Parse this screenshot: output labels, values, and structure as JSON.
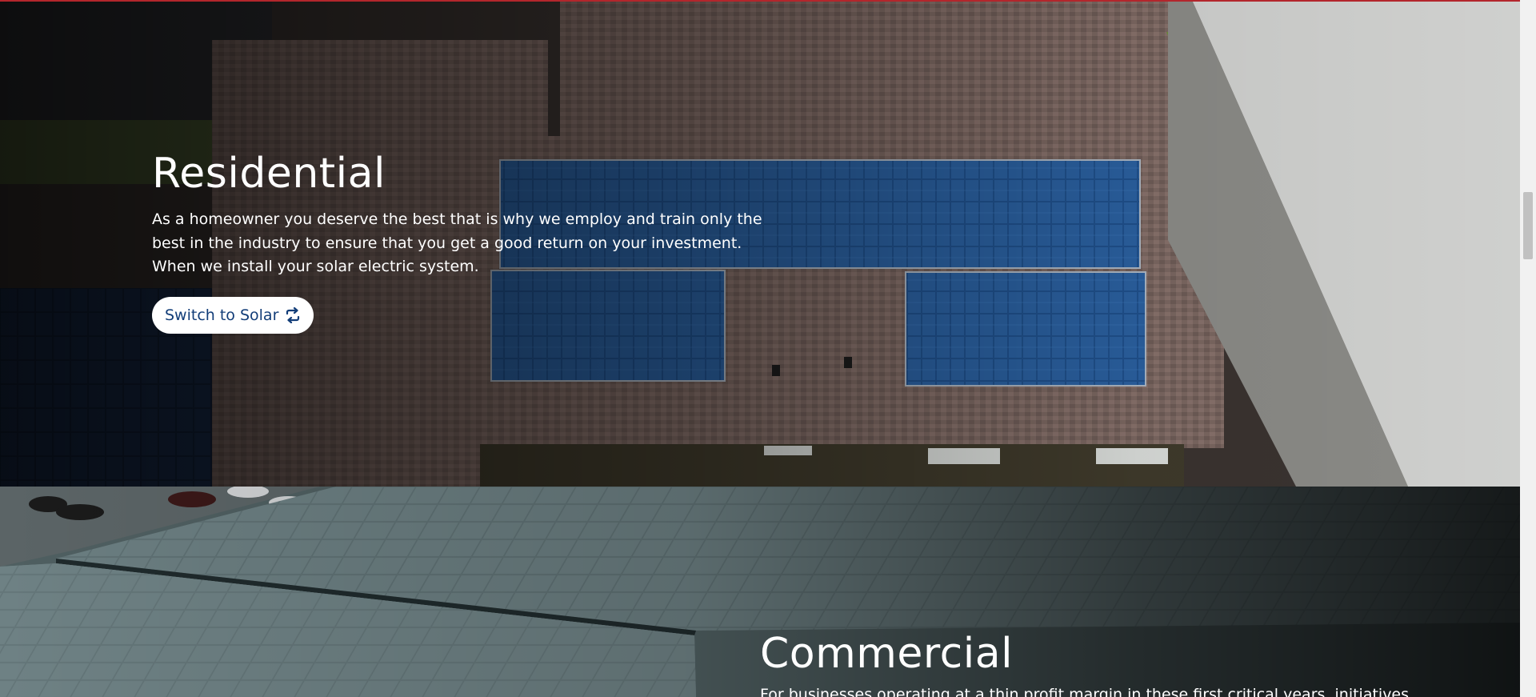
{
  "residential": {
    "title": "Residential",
    "body": "As a homeowner you deserve the best that is why we employ and train only the best in the industry to ensure that you get a good return on your investment. When we install your solar electric system.",
    "button_label": "Switch to Solar",
    "button_icon": "repeat-icon"
  },
  "commercial": {
    "title": "Commercial",
    "body": "For businesses operating at a thin profit margin in these first critical years, initiatives"
  },
  "colors": {
    "accent_line": "#b3262c",
    "button_text": "#123d78",
    "button_bg": "#ffffff"
  }
}
